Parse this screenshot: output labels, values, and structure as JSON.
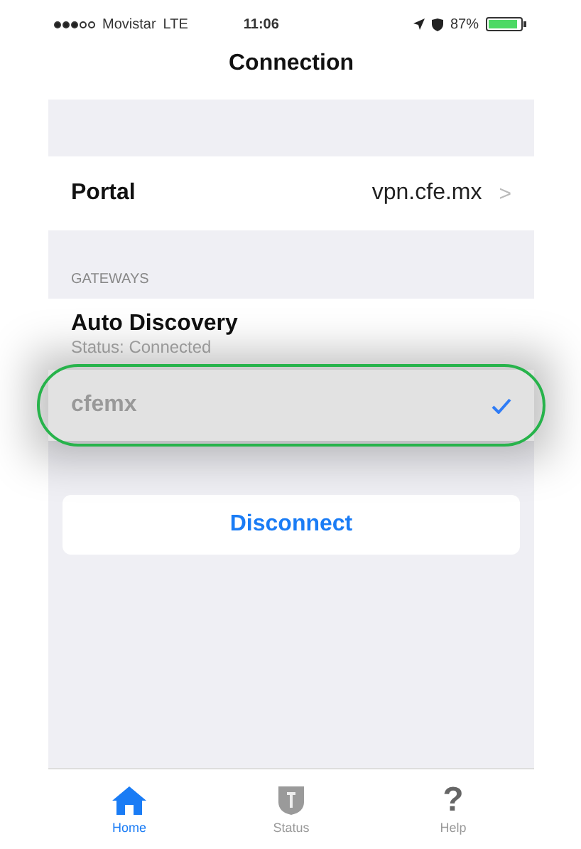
{
  "status_bar": {
    "carrier": "Movistar",
    "network": "LTE",
    "time": "11:06",
    "battery": "87%"
  },
  "nav": {
    "title": "Connection"
  },
  "portal": {
    "label": "Portal",
    "value": "vpn.cfe.mx",
    "chevron": ">"
  },
  "gateways": {
    "header": "GATEWAYS",
    "items": [
      {
        "name": "Auto Discovery",
        "status": "Status: Connected",
        "selected": false
      },
      {
        "name": "cfemx",
        "selected": true,
        "highlighted": true
      }
    ]
  },
  "disconnect_button": "Disconnect",
  "tabs": [
    {
      "label": "Home",
      "kind": "home",
      "selected": true
    },
    {
      "label": "Status",
      "kind": "shield",
      "selected": false
    },
    {
      "label": "Help",
      "kind": "help",
      "glyph": "?",
      "selected": false
    }
  ]
}
